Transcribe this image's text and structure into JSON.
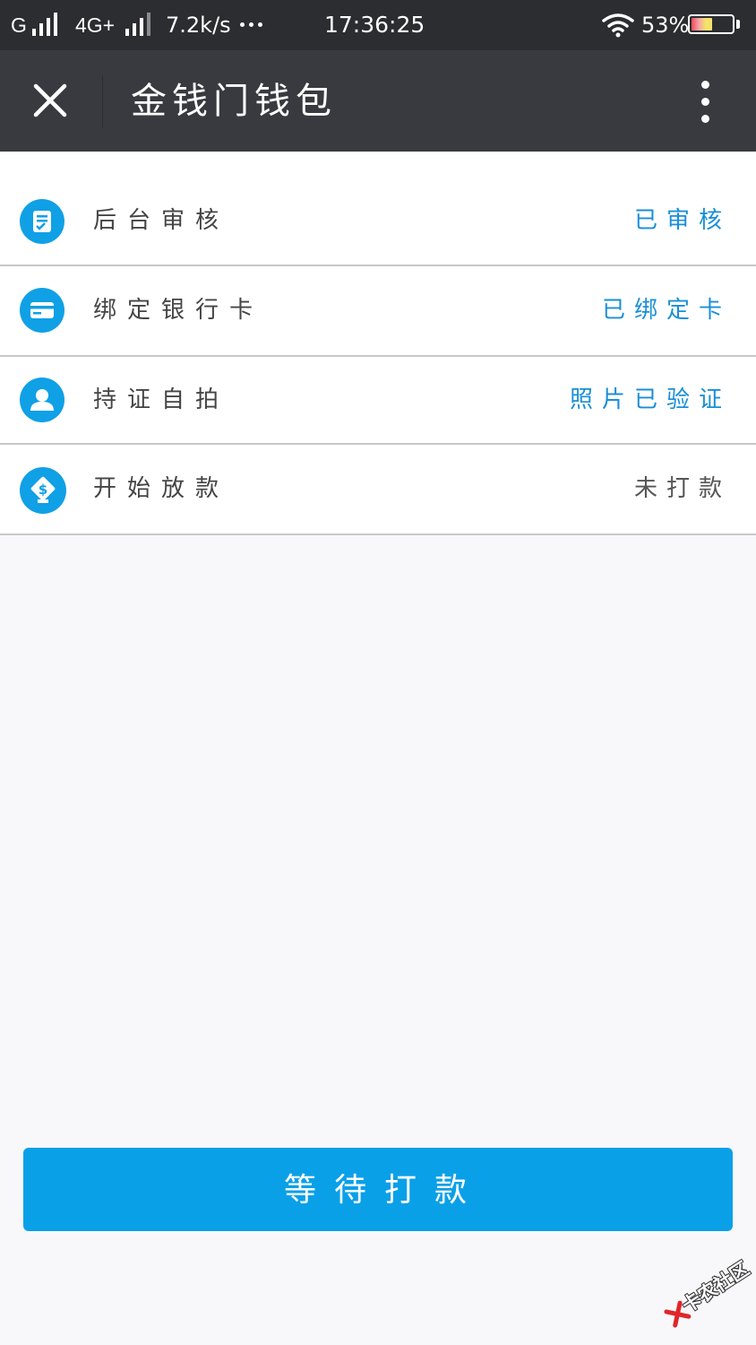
{
  "status_bar": {
    "carrier_1": "G",
    "carrier_2": "4G+",
    "net_speed": "7.2k/s",
    "time": "17:36:25",
    "battery_percent": "53%",
    "battery_level": 0.53,
    "signal_icon": "signal-bars-icon",
    "wifi_icon": "wifi-icon",
    "battery_icon": "battery-icon"
  },
  "navbar": {
    "title": "金钱门钱包",
    "close_icon": "close-icon",
    "more_icon": "more-vertical-icon"
  },
  "steps": [
    {
      "label": "后台审核",
      "status": "已审核",
      "status_color": "#1a8fd6",
      "icon": "audit-document-icon"
    },
    {
      "label": "绑定银行卡",
      "status": "已绑定卡",
      "status_color": "#1a8fd6",
      "icon": "bank-card-icon"
    },
    {
      "label": "持证自拍",
      "status": "照片已验证",
      "status_color": "#1a8fd6",
      "icon": "user-icon"
    },
    {
      "label": "开始放款",
      "status": "未打款",
      "status_color": "#555555",
      "icon": "money-hand-icon"
    }
  ],
  "main_button": {
    "label": "等待打款"
  },
  "watermark": {
    "text": "卡农社区"
  },
  "colors": {
    "accent": "#0aa0e8",
    "navbar_bg": "#393a3f",
    "statusbar_bg": "#2c2d31",
    "page_bg": "#f8f8fa"
  }
}
